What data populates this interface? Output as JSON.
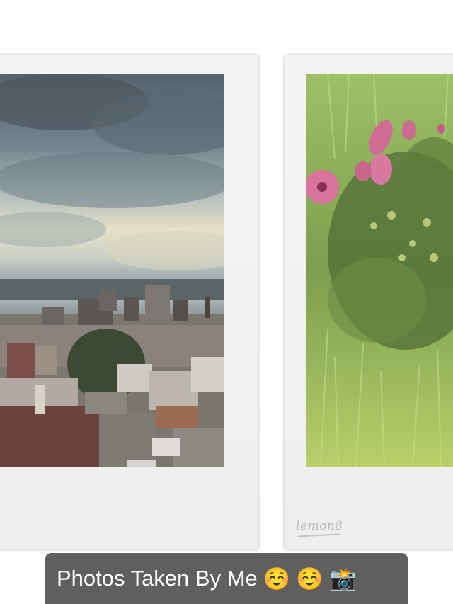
{
  "watermark": "lemon8",
  "caption": {
    "text": "Photos Taken By Me",
    "emojis": [
      "☺️",
      "☺️",
      "📸"
    ]
  },
  "photos": [
    {
      "subject": "city-skyline-storm-clouds"
    },
    {
      "subject": "pink-hibiscus-in-grass"
    }
  ],
  "colors": {
    "caption_bg": "#5f5f5f",
    "frame_bg": "#f1f1f1",
    "sky": "#6d7d86",
    "grass": "#a9c95d",
    "flower": "#d9739a"
  }
}
